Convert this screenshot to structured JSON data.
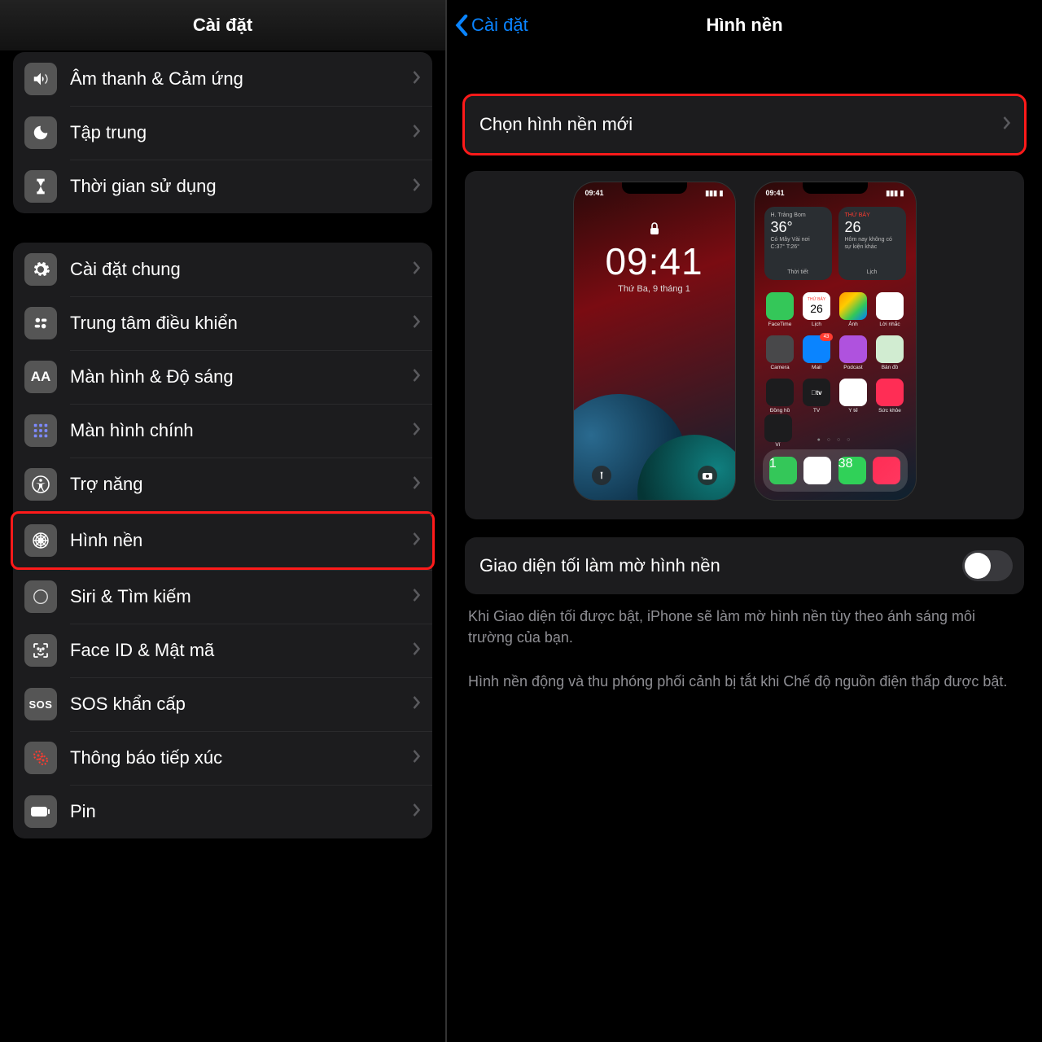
{
  "left": {
    "header_title": "Cài đặt",
    "group1": [
      {
        "key": "sound",
        "label": "Âm thanh & Cảm ứng"
      },
      {
        "key": "focus",
        "label": "Tập trung"
      },
      {
        "key": "screentime",
        "label": "Thời gian sử dụng"
      }
    ],
    "group2": [
      {
        "key": "general",
        "label": "Cài đặt chung"
      },
      {
        "key": "control",
        "label": "Trung tâm điều khiển"
      },
      {
        "key": "display",
        "label": "Màn hình & Độ sáng"
      },
      {
        "key": "home",
        "label": "Màn hình chính"
      },
      {
        "key": "access",
        "label": "Trợ năng"
      },
      {
        "key": "wallpaper",
        "label": "Hình nền",
        "highlight": true
      },
      {
        "key": "siri",
        "label": "Siri & Tìm kiếm"
      },
      {
        "key": "faceid",
        "label": "Face ID & Mật mã"
      },
      {
        "key": "sos",
        "label": "SOS khẩn cấp"
      },
      {
        "key": "exposure",
        "label": "Thông báo tiếp xúc"
      },
      {
        "key": "battery",
        "label": "Pin"
      }
    ]
  },
  "right": {
    "back_label": "Cài đặt",
    "header_title": "Hình nền",
    "choose_label": "Chọn hình nền mới",
    "lockscreen": {
      "status_time": "09:41",
      "time": "09:41",
      "date": "Thứ Ba, 9 tháng 1"
    },
    "homescreen": {
      "status_time": "09:41",
      "widget_weather": {
        "loc": "H. Trảng Bom",
        "temp": "36°",
        "detail": "Có Mây Vài nơi\nC:37° T:26°",
        "label": "Thời tiết"
      },
      "widget_cal": {
        "dow": "THỨ BẢY",
        "day": "26",
        "detail": "Hôm nay không có sự kiện khác",
        "label": "Lịch"
      },
      "apps_row1": [
        "FaceTime",
        "Lịch",
        "Ảnh",
        "Lời nhắc"
      ],
      "apps_row2": [
        "Camera",
        "Mail",
        "Podcast",
        "Bản đồ"
      ],
      "apps_row3": [
        "Đồng hồ",
        "TV",
        "Y tế",
        "Sức khỏe"
      ],
      "app_single": "Ví",
      "cal_day": "26",
      "cal_dow": "THỨ BẢY",
      "mail_badge": "43",
      "phone_badge": "1",
      "msg_badge": "38"
    },
    "toggle_label": "Giao diện tối làm mờ hình nền",
    "toggle_on": false,
    "footnote1": "Khi Giao diện tối được bật, iPhone sẽ làm mờ hình nền tùy theo ánh sáng môi trường của bạn.",
    "footnote2": "Hình nền động và thu phóng phối cảnh bị tắt khi Chế độ nguồn điện thấp được bật."
  }
}
